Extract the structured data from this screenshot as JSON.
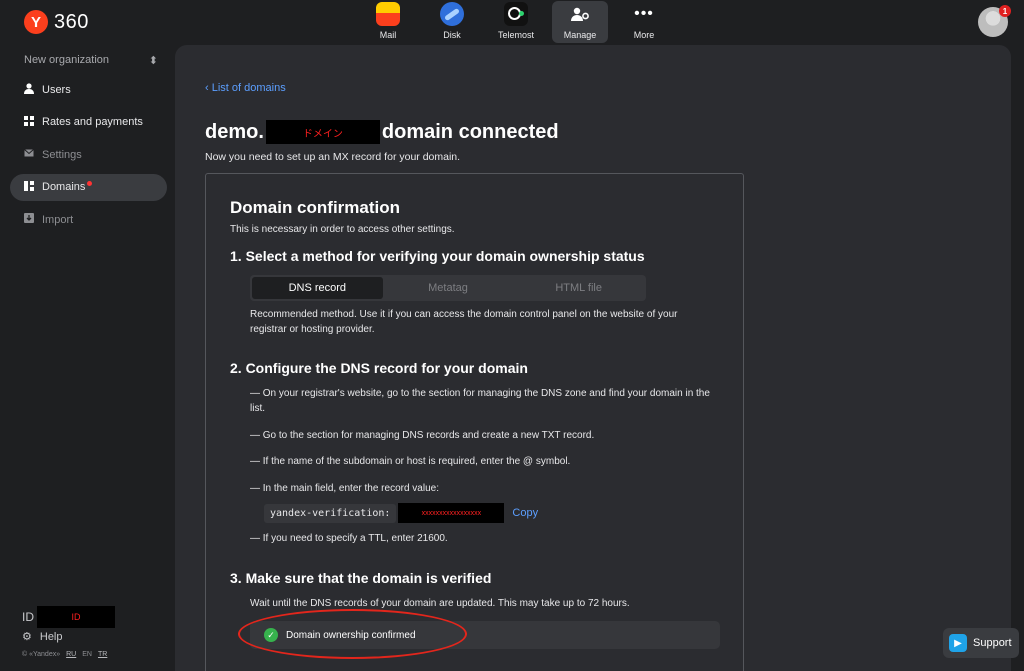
{
  "brand": {
    "logo_letter": "Y",
    "logo_number": "360"
  },
  "apps": [
    {
      "name": "Mail",
      "icon": "mail-icon"
    },
    {
      "name": "Disk",
      "icon": "disk-icon"
    },
    {
      "name": "Telemost",
      "icon": "telemost-icon"
    },
    {
      "name": "Manage",
      "icon": "manage-icon",
      "active": true
    },
    {
      "name": "More",
      "icon": "more-icon",
      "glyph": "•••"
    }
  ],
  "avatar": {
    "badge_count": "1"
  },
  "sidebar": {
    "organization": "New organization",
    "org_switch_glyph": "⬍",
    "items": [
      {
        "label": "Users",
        "icon": "user-icon",
        "glyph": "👤"
      },
      {
        "label": "Rates and payments",
        "icon": "grid-icon",
        "glyph": "▦"
      },
      {
        "label": "Settings",
        "icon": "mail-settings-icon",
        "glyph": "✉"
      },
      {
        "label": "Domains",
        "icon": "domains-icon",
        "glyph": "▥",
        "active": true
      },
      {
        "label": "Import",
        "icon": "import-icon",
        "glyph": "⇩"
      }
    ],
    "id_label": "ID",
    "id_redacted": "ID",
    "help_label": "Help",
    "help_glyph": "⚙",
    "footer": {
      "copyright": "© «Yandex»",
      "langs": [
        "RU",
        "EN",
        "TR"
      ]
    }
  },
  "main": {
    "back_link": "List of domains",
    "title_prefix": "demo.",
    "title_redacted": "ドメイン",
    "title_suffix": "domain connected",
    "subtitle": "Now you need to set up an MX record for your domain.",
    "card": {
      "title": "Domain confirmation",
      "subtitle": "This is necessary in order to access other settings.",
      "step1": {
        "heading": "1.  Select a method for verifying your domain ownership status",
        "tabs": [
          "DNS record",
          "Metatag",
          "HTML file"
        ],
        "active_tab": "DNS record",
        "description": "Recommended method. Use it if you can access the domain control panel on the website of your registrar or hosting provider."
      },
      "step2": {
        "heading": "2.  Configure the DNS record for your domain",
        "instructions": [
          "— On your registrar's website, go to the section for managing the DNS zone and find your domain in the list.",
          "— Go to the section for managing DNS records and create a new TXT record.",
          "— If the name of the subdomain or host is required, enter the @ symbol.",
          "— In the main field, enter the record value:",
          "— If you need to specify a TTL, enter 21600."
        ],
        "record_key": "yandex-verification:",
        "record_value_redacted": "xxxxxxxxxxxxxxxxx",
        "copy_label": "Copy"
      },
      "step3": {
        "heading": "3.  Make sure that the domain is verified",
        "description": "Wait until the DNS records of your domain are updated. This may take up to 72 hours.",
        "status": "Domain ownership confirmed"
      }
    }
  },
  "support": {
    "label": "Support"
  },
  "colors": {
    "accent": "#5c9fff",
    "brand_red": "#fc3f1d",
    "success": "#37b24d",
    "annotation": "#e3261c"
  }
}
